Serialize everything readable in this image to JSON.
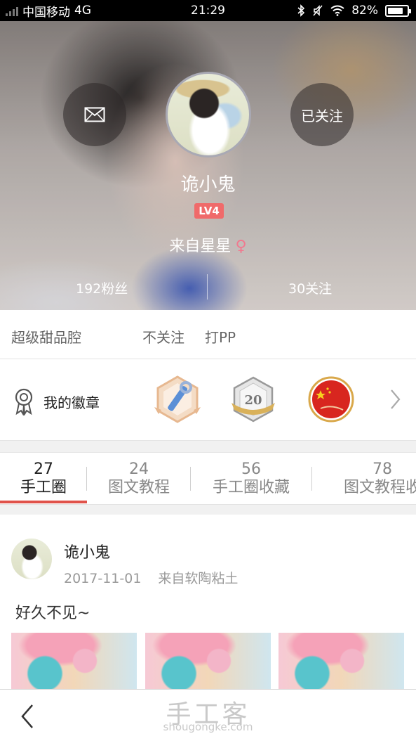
{
  "status_bar": {
    "carrier": "中国移动",
    "network": "4G",
    "time": "21:29",
    "battery": "82%",
    "battery_level": 0.82
  },
  "profile": {
    "name": "诡小鬼",
    "level": "LV4",
    "location": "来自星星",
    "gender_symbol": "♀",
    "fans": "192粉丝",
    "following": "30关注",
    "follow_button": "已关注"
  },
  "tags": [
    "超级甜品腔",
    "不关注",
    "打PP"
  ],
  "badges": {
    "label": "我的徽章",
    "medal_2_text": "20"
  },
  "tabs": [
    {
      "count": "27",
      "label": "手工圈"
    },
    {
      "count": "24",
      "label": "图文教程"
    },
    {
      "count": "56",
      "label": "手工圈收藏"
    },
    {
      "count": "78",
      "label": "图文教程收"
    }
  ],
  "post": {
    "author": "诡小鬼",
    "date": "2017-11-01",
    "source": "来自软陶粘土",
    "text": "好久不见~"
  },
  "footer": {
    "watermark_cn": "手工客",
    "watermark_en": "shougongke.com"
  },
  "colors": {
    "accent": "#e0524a",
    "level_badge": "#f06a6a",
    "gender": "#f1798f"
  },
  "icons": [
    "signal-icon",
    "bluetooth-icon",
    "mute-icon",
    "wifi-icon",
    "battery-icon",
    "mail-icon",
    "badge-ribbon-icon",
    "chevron-right-icon",
    "back-arrow-icon"
  ]
}
